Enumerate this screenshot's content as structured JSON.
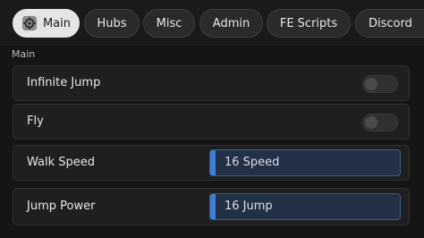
{
  "tabs": [
    {
      "label": "Main",
      "active": true,
      "icon": "gear-icon"
    },
    {
      "label": "Hubs"
    },
    {
      "label": "Misc"
    },
    {
      "label": "Admin"
    },
    {
      "label": "FE Scripts"
    },
    {
      "label": "Discord"
    }
  ],
  "section": {
    "title": "Main"
  },
  "rows": {
    "infinite_jump": {
      "label": "Infinite Jump",
      "enabled": false
    },
    "fly": {
      "label": "Fly",
      "enabled": false
    },
    "walk_speed": {
      "label": "Walk Speed",
      "value_text": "16 Speed",
      "value": 16,
      "fill_fraction": 0.03
    },
    "jump_power": {
      "label": "Jump Power",
      "value_text": "16 Jump",
      "value": 16,
      "fill_fraction": 0.03
    }
  },
  "colors": {
    "accent": "#3d7fd6",
    "active_tab": "#e4e4e4"
  }
}
